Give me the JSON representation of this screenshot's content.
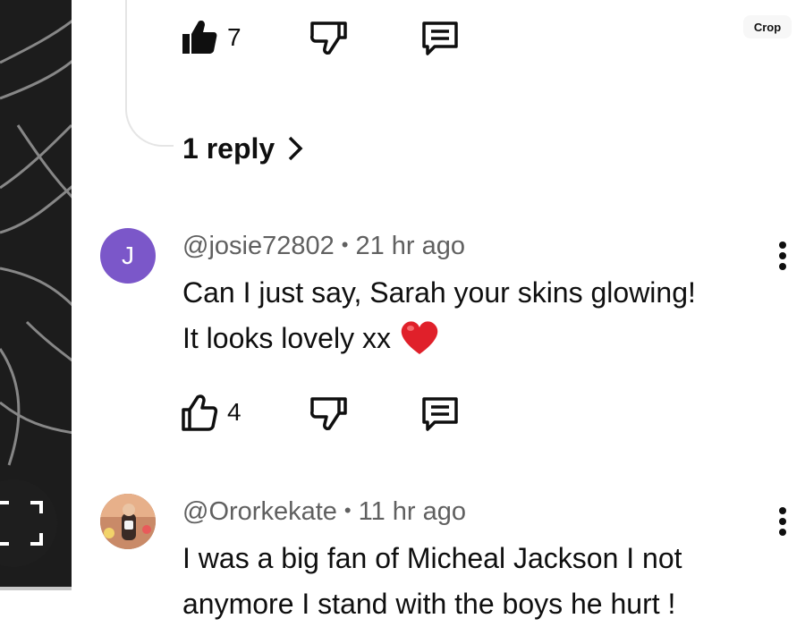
{
  "crop_label": "Crop",
  "top_comment": {
    "like_count": "7"
  },
  "replies_link": {
    "label": "1 reply"
  },
  "comments": [
    {
      "avatar_letter": "J",
      "avatar_color": "#7b57c9",
      "author": "@josie72802",
      "separator": "•",
      "time": "21 hr ago",
      "text_line1": "Can I just say, Sarah your skins glowing!",
      "text_line2": "It looks lovely xx",
      "emoji": "red-heart",
      "like_count": "4"
    },
    {
      "avatar_letter": "",
      "author": "@Ororkekate",
      "separator": "•",
      "time": "11 hr ago",
      "text_line1": "I was a big fan of Micheal Jackson I not",
      "text_line2": "anymore I stand with the boys he hurt !"
    }
  ],
  "icons": {
    "like_filled": "thumbs-up-filled-icon",
    "like": "thumbs-up-icon",
    "dislike": "thumbs-down-icon",
    "reply": "comment-icon",
    "more": "more-vert-icon",
    "chevron": "chevron-right-icon",
    "fullscreen": "fullscreen-icon"
  }
}
